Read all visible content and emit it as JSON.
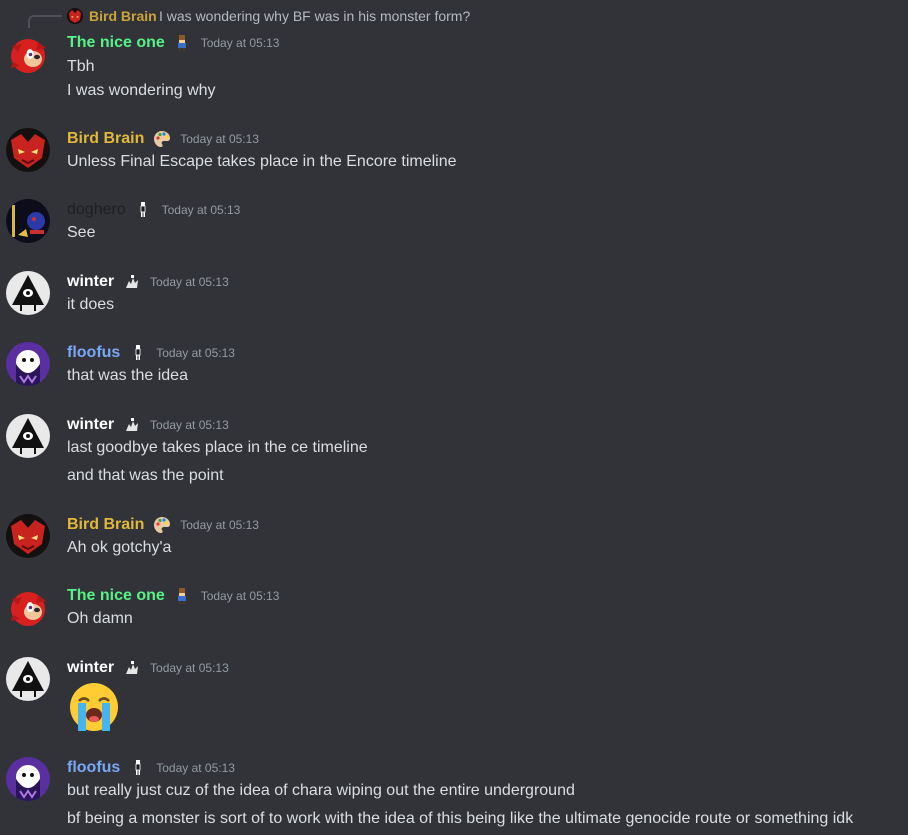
{
  "colors": {
    "background": "#313338",
    "message_text": "#dbdee1",
    "timestamp": "#949ba4",
    "the_nice_one": "#57f287",
    "bird_brain": "#e2b83b",
    "doghero": "#1e1f22",
    "winter": "#ffffff",
    "floofus": "#7aa6f7"
  },
  "reply": {
    "author": "Bird Brain",
    "text": "I was wondering why BF was in his monster form?"
  },
  "messages": [
    {
      "author": "The nice one",
      "role_icon": "pixel-character-icon",
      "time": "Today at 05:13",
      "lines": [
        "Tbh",
        "I was wondering why"
      ]
    },
    {
      "author": "Bird Brain",
      "role_icon": "paint-palette-icon",
      "time": "Today at 05:13",
      "lines": [
        "Unless Final Escape takes place in the Encore timeline"
      ]
    },
    {
      "author": "doghero",
      "role_icon": "pixel-figure-icon",
      "time": "Today at 05:13",
      "lines": [
        "See"
      ]
    },
    {
      "author": "winter",
      "role_icon": "pixel-sprite-icon",
      "time": "Today at 05:13",
      "lines": [
        "it does"
      ]
    },
    {
      "author": "floofus",
      "role_icon": "pixel-figure-icon",
      "time": "Today at 05:13",
      "lines": [
        "that was the idea"
      ]
    },
    {
      "author": "winter",
      "role_icon": "pixel-sprite-icon",
      "time": "Today at 05:13",
      "lines": [
        "last goodbye takes place in the ce timeline",
        "and that was the point"
      ]
    },
    {
      "author": "Bird Brain",
      "role_icon": "paint-palette-icon",
      "time": "Today at 05:13",
      "lines": [
        "Ah ok gotchy'a"
      ]
    },
    {
      "author": "The nice one",
      "role_icon": "pixel-character-icon",
      "time": "Today at 05:13",
      "lines": [
        "Oh damn"
      ]
    },
    {
      "author": "winter",
      "role_icon": "pixel-sprite-icon",
      "time": "Today at 05:13",
      "emoji": "😭",
      "emoji_name": "loudly-crying-emoji"
    },
    {
      "author": "floofus",
      "role_icon": "pixel-figure-icon",
      "time": "Today at 05:13",
      "lines": [
        "but really just cuz of the idea of chara wiping out the entire underground",
        "bf being a monster is sort of to work with the idea of this being like the ultimate genocide route or something idk"
      ]
    }
  ]
}
